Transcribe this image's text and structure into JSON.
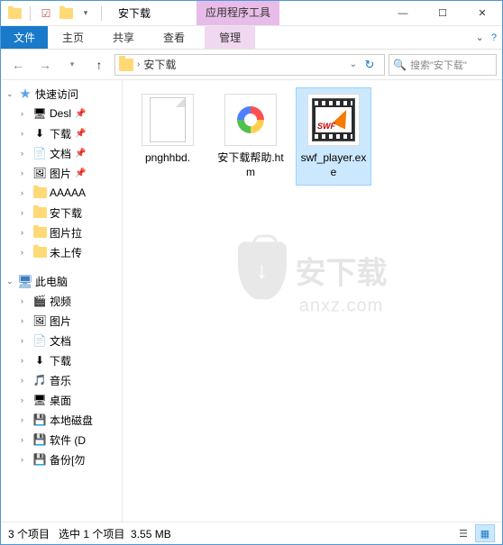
{
  "window": {
    "title": "安下载",
    "context_tab_header": "应用程序工具"
  },
  "ribbon": {
    "file": "文件",
    "home": "主页",
    "share": "共享",
    "view": "查看",
    "manage": "管理"
  },
  "nav": {
    "breadcrumb": "安下载",
    "search_placeholder": "搜索\"安下载\""
  },
  "sidebar": {
    "quick_access": "快速访问",
    "items_qa": [
      {
        "label": "Desl",
        "pinned": true
      },
      {
        "label": "下载",
        "pinned": true
      },
      {
        "label": "文档",
        "pinned": true
      },
      {
        "label": "图片",
        "pinned": true
      },
      {
        "label": "AAAAA",
        "pinned": false
      },
      {
        "label": "安下载",
        "pinned": false
      },
      {
        "label": "图片拉",
        "pinned": false
      },
      {
        "label": "未上传",
        "pinned": false
      }
    ],
    "this_pc": "此电脑",
    "items_pc": [
      {
        "label": "视频"
      },
      {
        "label": "图片"
      },
      {
        "label": "文档"
      },
      {
        "label": "下载"
      },
      {
        "label": "音乐"
      },
      {
        "label": "桌面"
      },
      {
        "label": "本地磁盘"
      },
      {
        "label": "软件 (D"
      },
      {
        "label": "备份[勿"
      }
    ]
  },
  "files": [
    {
      "name": "pnghhbd.",
      "type": "blank"
    },
    {
      "name": "安下载帮助.htm",
      "type": "htm"
    },
    {
      "name": "swf_player.exe",
      "type": "swf",
      "selected": true
    }
  ],
  "watermark": {
    "text1": "安下载",
    "text2": "anxz.com"
  },
  "status": {
    "count": "3 个项目",
    "selected": "选中 1 个项目",
    "size": "3.55 MB"
  }
}
